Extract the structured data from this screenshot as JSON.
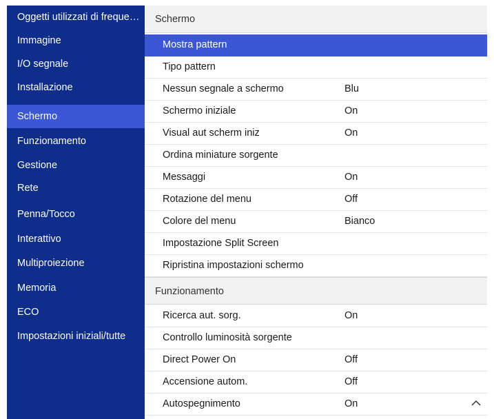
{
  "sidebar": {
    "items": [
      {
        "label": "Oggetti utilizzati di frequenza"
      },
      {
        "label": "Immagine"
      },
      {
        "label": "I/O segnale"
      },
      {
        "label": "Installazione"
      },
      {
        "label": "Schermo"
      },
      {
        "label": "Funzionamento"
      },
      {
        "label": "Gestione"
      },
      {
        "label": "Rete"
      },
      {
        "label": "Penna/Tocco"
      },
      {
        "label": "Interattivo"
      },
      {
        "label": "Multiproiezione"
      },
      {
        "label": "Memoria"
      },
      {
        "label": "ECO"
      },
      {
        "label": "Impostazioni iniziali/tutte"
      }
    ],
    "active_label": "Schermo"
  },
  "sections": [
    {
      "title": "Schermo",
      "rows": [
        {
          "label": "Mostra pattern",
          "value": ""
        },
        {
          "label": "Tipo pattern",
          "value": ""
        },
        {
          "label": "Nessun segnale a schermo",
          "value": "Blu"
        },
        {
          "label": "Schermo iniziale",
          "value": "On"
        },
        {
          "label": "Visual aut scherm iniz",
          "value": "On"
        },
        {
          "label": "Ordina miniature sorgente",
          "value": ""
        },
        {
          "label": "Messaggi",
          "value": "On"
        },
        {
          "label": "Rotazione del menu",
          "value": "Off"
        },
        {
          "label": "Colore del menu",
          "value": "Bianco"
        },
        {
          "label": "Impostazione Split Screen",
          "value": ""
        },
        {
          "label": "Ripristina impostazioni schermo",
          "value": ""
        }
      ]
    },
    {
      "title": "Funzionamento",
      "rows": [
        {
          "label": "Ricerca aut. sorg.",
          "value": "On"
        },
        {
          "label": "Controllo luminosità sorgente",
          "value": ""
        },
        {
          "label": "Direct Power On",
          "value": "Off"
        },
        {
          "label": "Accensione autom.",
          "value": "Off"
        },
        {
          "label": "Autospegnimento",
          "value": "On"
        }
      ]
    }
  ],
  "selected_row_label": "Mostra pattern",
  "icons": {
    "scroll_up": "chevron-up-icon"
  },
  "colors": {
    "sidebar_bg": "#0f2d8a",
    "accent": "#3b57d6",
    "section_header_bg": "#f2f2f2"
  }
}
